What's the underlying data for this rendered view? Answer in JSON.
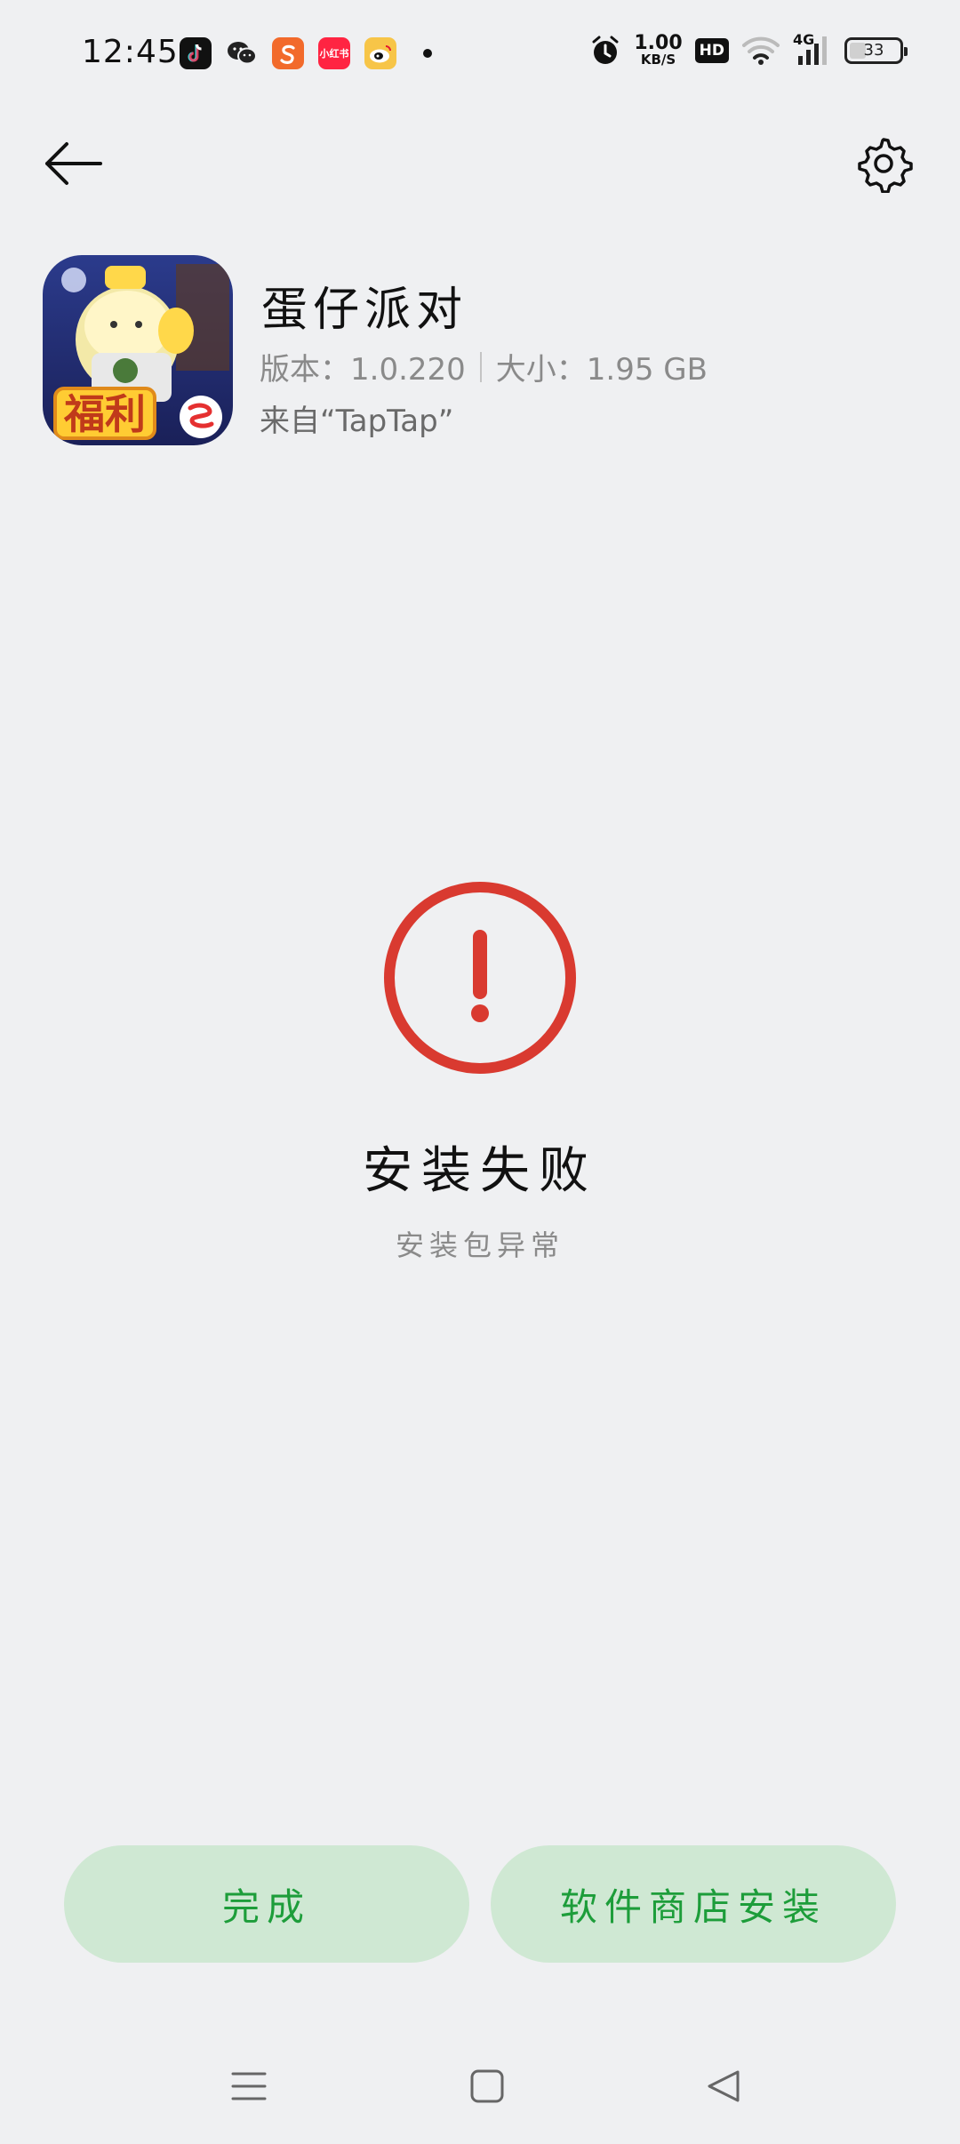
{
  "status_bar": {
    "time": "12:45",
    "net_speed_value": "1.00",
    "net_speed_unit": "KB/S",
    "hd_label": "HD",
    "network_type": "4G",
    "battery_level": "33",
    "app_icons": [
      "douyin-icon",
      "wechat-icon",
      "sohu-icon",
      "xiaohongshu-icon",
      "weibo-icon"
    ],
    "xhs_label": "小红书"
  },
  "app": {
    "name": "蛋仔派对",
    "version_label": "版本：1.0.220",
    "size_label": "大小：1.95 GB",
    "source": "来自“TapTap”",
    "icon_badge_text": "福利"
  },
  "result": {
    "status_color": "#d93a30",
    "title": "安装失败",
    "subtitle": "安装包异常"
  },
  "actions": {
    "done_label": "完成",
    "store_install_label": "软件商店安装"
  }
}
